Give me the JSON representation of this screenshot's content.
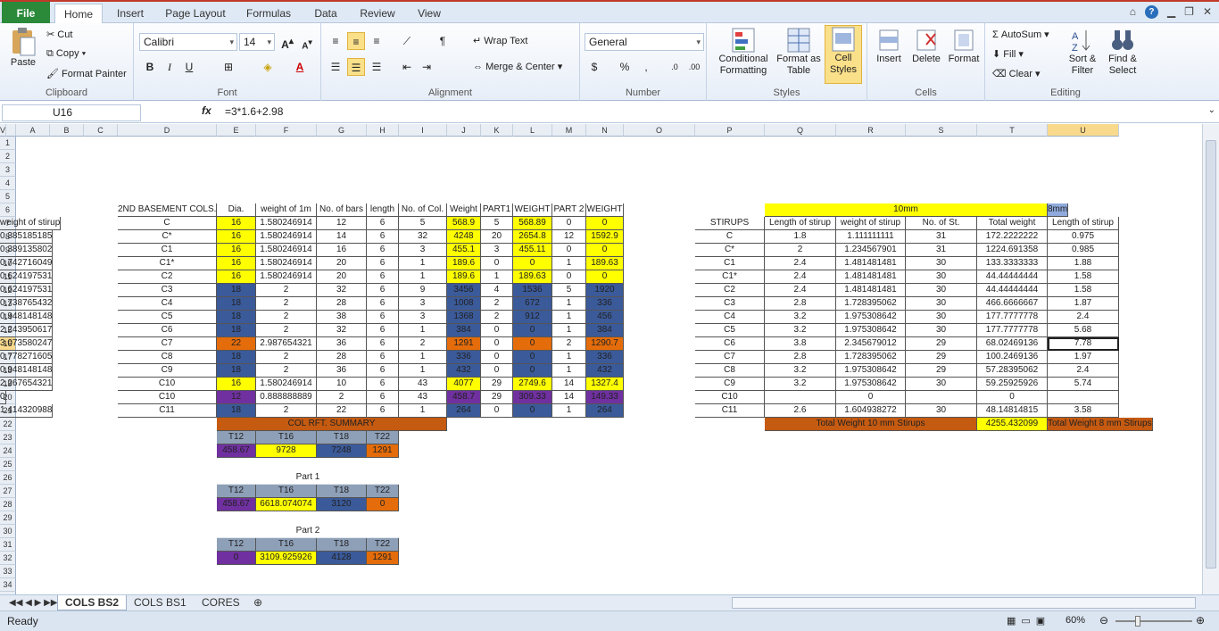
{
  "tabs": [
    "File",
    "Home",
    "Insert",
    "Page Layout",
    "Formulas",
    "Data",
    "Review",
    "View"
  ],
  "ribbon": {
    "clipboard": {
      "paste": "Paste",
      "cut": "Cut",
      "copy": "Copy",
      "format_painter": "Format Painter",
      "label": "Clipboard"
    },
    "font": {
      "name": "Calibri",
      "size": "14",
      "label": "Font"
    },
    "alignment": {
      "wrap": "Wrap Text",
      "merge": "Merge & Center",
      "label": "Alignment"
    },
    "number": {
      "format": "General",
      "label": "Number"
    },
    "styles": {
      "cond": "Conditional Formatting",
      "table": "Format as Table",
      "cell": "Cell Styles",
      "label": "Styles"
    },
    "cells": {
      "insert": "Insert",
      "delete": "Delete",
      "format": "Format",
      "label": "Cells"
    },
    "editing": {
      "autosum": "AutoSum",
      "fill": "Fill",
      "clear": "Clear",
      "sort": "Sort & Filter",
      "find": "Find & Select",
      "label": "Editing"
    }
  },
  "formula": {
    "cell": "U16",
    "fx": "fx",
    "value": "=3*1.6+2.98"
  },
  "columns": [
    "A",
    "B",
    "C",
    "D",
    "E",
    "F",
    "G",
    "H",
    "I",
    "J",
    "K",
    "L",
    "M",
    "N",
    "O",
    "P",
    "Q",
    "R",
    "S",
    "T",
    "U",
    "V"
  ],
  "rows": [
    "1",
    "2",
    "3",
    "4",
    "5",
    "6",
    "7",
    "8",
    "9",
    "10",
    "11",
    "12",
    "13",
    "14",
    "15",
    "16",
    "17",
    "18",
    "19",
    "20",
    "21",
    "22",
    "23",
    "24",
    "25",
    "26",
    "27",
    "28",
    "29",
    "30",
    "31",
    "32",
    "33",
    "34",
    "35"
  ],
  "left_table": {
    "header": [
      "2ND BASEMENT COLS.",
      "Dia.",
      "weight of 1m",
      "No. of bars",
      "length",
      "No. of Col.",
      "Weight",
      "PART1",
      "WEIGHT",
      "PART 2",
      "WEIGHT"
    ],
    "rows": [
      [
        "C",
        "16",
        "1.580246914",
        "12",
        "6",
        "5",
        "568.9",
        "5",
        "568.89",
        "0",
        "0"
      ],
      [
        "C*",
        "16",
        "1.580246914",
        "14",
        "6",
        "32",
        "4248",
        "20",
        "2654.8",
        "12",
        "1592.9"
      ],
      [
        "C1",
        "16",
        "1.580246914",
        "16",
        "6",
        "3",
        "455.1",
        "3",
        "455.11",
        "0",
        "0"
      ],
      [
        "C1*",
        "16",
        "1.580246914",
        "20",
        "6",
        "1",
        "189.6",
        "0",
        "0",
        "1",
        "189.63"
      ],
      [
        "C2",
        "16",
        "1.580246914",
        "20",
        "6",
        "1",
        "189.6",
        "1",
        "189.63",
        "0",
        "0"
      ],
      [
        "C3",
        "18",
        "2",
        "32",
        "6",
        "9",
        "3456",
        "4",
        "1536",
        "5",
        "1920"
      ],
      [
        "C4",
        "18",
        "2",
        "28",
        "6",
        "3",
        "1008",
        "2",
        "672",
        "1",
        "336"
      ],
      [
        "C5",
        "18",
        "2",
        "38",
        "6",
        "3",
        "1368",
        "2",
        "912",
        "1",
        "456"
      ],
      [
        "C6",
        "18",
        "2",
        "32",
        "6",
        "1",
        "384",
        "0",
        "0",
        "1",
        "384"
      ],
      [
        "C7",
        "22",
        "2.987654321",
        "36",
        "6",
        "2",
        "1291",
        "0",
        "0",
        "2",
        "1290.7"
      ],
      [
        "C8",
        "18",
        "2",
        "28",
        "6",
        "1",
        "336",
        "0",
        "0",
        "1",
        "336"
      ],
      [
        "C9",
        "18",
        "2",
        "36",
        "6",
        "1",
        "432",
        "0",
        "0",
        "1",
        "432"
      ],
      [
        "C10",
        "16",
        "1.580246914",
        "10",
        "6",
        "43",
        "4077",
        "29",
        "2749.6",
        "14",
        "1327.4"
      ],
      [
        "C10",
        "12",
        "0.888888889",
        "2",
        "6",
        "43",
        "458.7",
        "29",
        "309.33",
        "14",
        "149.33"
      ],
      [
        "C11",
        "18",
        "2",
        "22",
        "6",
        "1",
        "264",
        "0",
        "0",
        "1",
        "264"
      ]
    ]
  },
  "summary": {
    "title": "COL RFT. SUMMARY",
    "part1": "Part 1",
    "part2": "Part 2",
    "headers": [
      "T12",
      "T16",
      "T18",
      "T22"
    ],
    "total": [
      "458.67",
      "9728",
      "7248",
      "1291"
    ],
    "p1": [
      "458.67",
      "6618.074074",
      "3120",
      "0"
    ],
    "p2": [
      "0",
      "3109.925926",
      "4128",
      "1291"
    ]
  },
  "right_table": {
    "band10": "10mm",
    "band8": "8mm",
    "header": [
      "STIRUPS",
      "Length of stirup",
      "weight of stirup",
      "No. of St.",
      "Total weight",
      "Length of stirup",
      "weight of stirup"
    ],
    "rows": [
      [
        "C",
        "1.8",
        "1.111111111",
        "31",
        "172.2222222",
        "0.975",
        "0.385185185"
      ],
      [
        "C*",
        "2",
        "1.234567901",
        "31",
        "1224.691358",
        "0.985",
        "0.389135802"
      ],
      [
        "C1",
        "2.4",
        "1.481481481",
        "30",
        "133.3333333",
        "1.88",
        "0.742716049"
      ],
      [
        "C1*",
        "2.4",
        "1.481481481",
        "30",
        "44.44444444",
        "1.58",
        "0.624197531"
      ],
      [
        "C2",
        "2.4",
        "1.481481481",
        "30",
        "44.44444444",
        "1.58",
        "0.624197531"
      ],
      [
        "C3",
        "2.8",
        "1.728395062",
        "30",
        "466.6666667",
        "1.87",
        "0.738765432"
      ],
      [
        "C4",
        "3.2",
        "1.975308642",
        "30",
        "177.7777778",
        "2.4",
        "0.948148148"
      ],
      [
        "C5",
        "3.2",
        "1.975308642",
        "30",
        "177.7777778",
        "5.68",
        "2.243950617"
      ],
      [
        "C6",
        "3.8",
        "2.345679012",
        "29",
        "68.02469136",
        "7.78",
        "3.073580247"
      ],
      [
        "C7",
        "2.8",
        "1.728395062",
        "29",
        "100.2469136",
        "1.97",
        "0.778271605"
      ],
      [
        "C8",
        "3.2",
        "1.975308642",
        "29",
        "57.28395062",
        "2.4",
        "0.948148148"
      ],
      [
        "C9",
        "3.2",
        "1.975308642",
        "30",
        "59.25925926",
        "5.74",
        "2.267654321"
      ],
      [
        "C10",
        "",
        "0",
        "",
        "0",
        "",
        "0"
      ],
      [
        "C11",
        "2.6",
        "1.604938272",
        "30",
        "48.14814815",
        "3.58",
        "1.414320988"
      ]
    ],
    "total10_label": "Total Weight 10 mm Stirups",
    "total10": "4255.432099",
    "total8_label": "Total Weight 8 mm Stirups"
  },
  "sheets": [
    "COLS BS2",
    "COLS BS1",
    "CORES"
  ],
  "status": {
    "ready": "Ready",
    "zoom": "60%"
  },
  "colors": {
    "yellow": "#ffff00",
    "blue": "#3b5a9a",
    "purple": "#7030a0",
    "orange": "#e46c0a",
    "file_tab": "#2a8a3a"
  }
}
